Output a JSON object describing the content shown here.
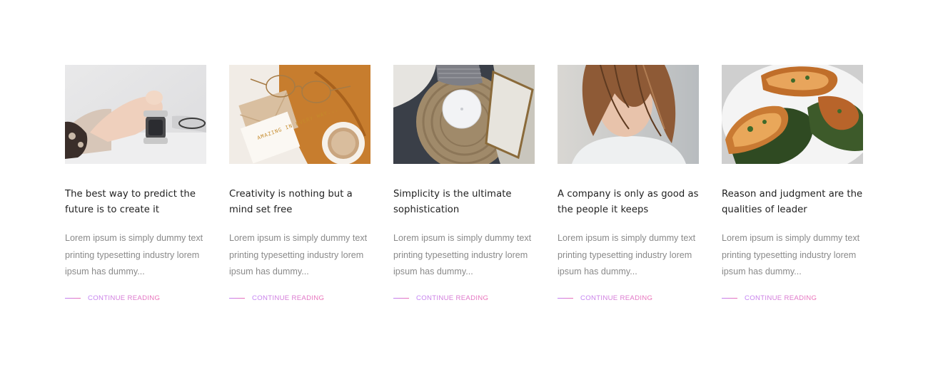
{
  "theme": {
    "accent_start": "#c082f5",
    "accent_end": "#ec6fb5"
  },
  "posts": [
    {
      "title": "The best way to predict the future is to create it",
      "excerpt": "Lorem ipsum is simply dummy text printing typesetting industry lorem ipsum has dummy...",
      "link": "CONTINUE READING",
      "image": "hand-holding-smartwatch-photo"
    },
    {
      "title": "Creativity is nothing but a mind set free",
      "excerpt": "Lorem ipsum is simply dummy text printing typesetting industry lorem ipsum has dummy...",
      "link": "CONTINUE READING",
      "image": "glasses-card-coffee-photo",
      "image_text": "AMAZING IN EVERY WAY..."
    },
    {
      "title": "Simplicity is the ultimate sophistication",
      "excerpt": "Lorem ipsum is simply dummy text printing typesetting industry lorem ipsum has dummy...",
      "link": "CONTINUE READING",
      "image": "pillow-on-rug-photo"
    },
    {
      "title": "A company is only as good as the people it keeps",
      "excerpt": "Lorem ipsum is simply dummy text printing typesetting industry lorem ipsum has dummy...",
      "link": "CONTINUE READING",
      "image": "woman-hair-over-face-photo"
    },
    {
      "title": "Reason and judgment are the qualities of leader",
      "excerpt": "Lorem ipsum is simply dummy text printing typesetting industry lorem ipsum has dummy...",
      "link": "CONTINUE READING",
      "image": "bruschetta-plate-photo"
    }
  ]
}
